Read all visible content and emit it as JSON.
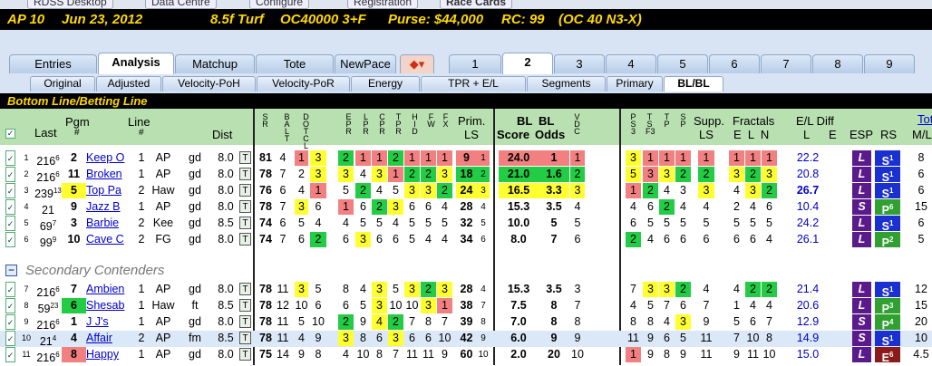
{
  "app_tabs": [
    "RDSS Desktop",
    "Data Centre",
    "Configure",
    "Registration",
    "Race Cards"
  ],
  "header": {
    "track_race": "AP 10",
    "date": "Jun 23, 2012",
    "dist_surf": "8.5f Turf",
    "class": "OC40000 3+F",
    "purse": "Purse: $44,000",
    "rc": "RC: 99",
    "oc": "(OC 40 N3-X)"
  },
  "main_tabs": [
    "Entries",
    "Analysis",
    "Matchup",
    "Tote",
    "NewPace",
    "1",
    "2",
    "3",
    "4",
    "5",
    "6",
    "7",
    "8",
    "9"
  ],
  "sub_tabs": [
    "Original",
    "Adjusted",
    "Velocity-PoH",
    "Velocity-PoR",
    "Energy",
    "TPR + E/L",
    "Segments",
    "Primary",
    "BL/BL"
  ],
  "section_title": "Bottom Line/Betting Line",
  "columns": {
    "last": "Last",
    "pgm": "Pgm",
    "pgm_no": "#",
    "line": "Line",
    "line_no": "#",
    "dist": "Dist",
    "srlabel": "S\nR",
    "balt": "B\nA\nL\nT",
    "dotcl": "D\nO\nT\nC\nL",
    "ep": "E\nP\nR",
    "lp": "L\nP\nR",
    "cp": "C\nP\nR",
    "tp": "T\nP\nR",
    "hid": "H\nI\nD",
    "fw": "F\nW",
    "fx": "F\nX",
    "prim": "Prim.",
    "ls": "LS",
    "bl1": "BL",
    "bl2": "BL",
    "score": "Score",
    "odds": "Odds",
    "vdc": "V\nD\nC",
    "ps": "P\nS\n3",
    "ts": "T\nS\nF3",
    "t3": "T\nP",
    "s3": "S\nP",
    "supp": "Supp.",
    "supp_ls": "LS",
    "fractals": "Fractals",
    "eln": "E  L  N",
    "eldiff": "E/L Diff",
    "l": "L",
    "e": "E",
    "esp": "ESP",
    "rs": "RS",
    "tot": "Tot",
    "ml": "M/L"
  },
  "secondary": "Secondary Contenders",
  "rows": [
    {
      "n": "1",
      "last": "216",
      "ls": "6",
      "pgm": "2",
      "name": "Keep O",
      "line": "1",
      "trk": "AP",
      "cond": "gd",
      "dist": "8.0",
      "sr": "81",
      "b": "4",
      "d1": "1",
      "d2": "3",
      "e": [
        "2",
        "1",
        "1",
        "2",
        "1",
        "1",
        "1"
      ],
      "prim": "9",
      "p2": "1",
      "score": "24.0",
      "odds": "1",
      "vdc": "1",
      "ps": [
        "3",
        "1",
        "1",
        "1"
      ],
      "supp": "1",
      "fr": [
        "1",
        "1",
        "1"
      ],
      "eld": "22.2",
      "esp": "L",
      "rs": "S",
      "rsx": "1",
      "ml": "8",
      "c": [
        "L",
        "L",
        "R",
        "Y",
        "G",
        "R",
        "R",
        "G",
        "R",
        "R",
        "R",
        "R",
        "",
        "R",
        "R",
        "R",
        "Y",
        "R",
        "R",
        "R",
        "R",
        "R",
        "R",
        "R"
      ]
    },
    {
      "n": "2",
      "last": "216",
      "ls": "6",
      "pgm": "11",
      "name": "Broken",
      "line": "1",
      "trk": "AP",
      "cond": "gd",
      "dist": "8.0",
      "sr": "78",
      "b": "7",
      "d1": "2",
      "d2": "3",
      "e": [
        "3",
        "4",
        "3",
        "1",
        "2",
        "2",
        "3"
      ],
      "prim": "18",
      "p2": "2",
      "score": "21.0",
      "odds": "1.6",
      "vdc": "2",
      "ps": [
        "5",
        "3",
        "3",
        "2"
      ],
      "supp": "2",
      "fr": [
        "3",
        "2",
        "3"
      ],
      "eld": "20.8",
      "esp": "L",
      "rs": "S",
      "rsx": "1",
      "ml": "6"
    },
    {
      "n": "3",
      "last": "239",
      "ls": "13",
      "pgm": "5",
      "name": "Top Pa",
      "line": "2",
      "trk": "Haw",
      "cond": "gd",
      "dist": "8.0",
      "sr": "76",
      "b": "6",
      "d1": "4",
      "d2": "1",
      "e": [
        "5",
        "2",
        "4",
        "5",
        "3",
        "3",
        "2"
      ],
      "prim": "24",
      "p2": "3",
      "score": "16.5",
      "odds": "3.3",
      "vdc": "3",
      "ps": [
        "1",
        "2",
        "4",
        "3"
      ],
      "supp": "3",
      "fr": [
        "4",
        "3",
        "2"
      ],
      "eld": "26.7",
      "esp": "L",
      "rs": "S",
      "rsx": "1",
      "ml": "6"
    },
    {
      "n": "4",
      "last": "21",
      "ls": "",
      "pgm": "9",
      "name": "Jazz B",
      "line": "1",
      "trk": "AP",
      "cond": "gd",
      "dist": "8.0",
      "sr": "78",
      "b": "7",
      "d1": "3",
      "d2": "6",
      "e": [
        "1",
        "6",
        "2",
        "3",
        "6",
        "6",
        "4"
      ],
      "prim": "28",
      "p2": "4",
      "score": "15.3",
      "odds": "3.5",
      "vdc": "4",
      "ps": [
        "4",
        "6",
        "2",
        "4"
      ],
      "supp": "4",
      "fr": [
        "2",
        "4",
        "6"
      ],
      "eld": "10.4",
      "esp": "S",
      "rs": "P",
      "rsx": "6",
      "ml": "15"
    },
    {
      "n": "5",
      "last": "69",
      "ls": "7",
      "pgm": "3",
      "name": "Barbie",
      "line": "2",
      "trk": "Kee",
      "cond": "gd",
      "dist": "8.5",
      "sr": "74",
      "b": "6",
      "d1": "5",
      "d2": "4",
      "e": [
        "4",
        "5",
        "5",
        "4",
        "5",
        "5",
        "5"
      ],
      "prim": "32",
      "p2": "5",
      "score": "10.0",
      "odds": "5",
      "vdc": "5",
      "ps": [
        "6",
        "5",
        "5",
        "5"
      ],
      "supp": "5",
      "fr": [
        "5",
        "5",
        "5"
      ],
      "eld": "24.2",
      "esp": "L",
      "rs": "S",
      "rsx": "1",
      "ml": "6"
    },
    {
      "n": "6",
      "last": "99",
      "ls": "9",
      "pgm": "10",
      "name": "Cave C",
      "line": "2",
      "trk": "FG",
      "cond": "gd",
      "dist": "8.0",
      "sr": "74",
      "b": "7",
      "d1": "6",
      "d2": "2",
      "e": [
        "6",
        "3",
        "6",
        "6",
        "5",
        "4",
        "4"
      ],
      "prim": "34",
      "p2": "6",
      "score": "8.0",
      "odds": "7",
      "vdc": "6",
      "ps": [
        "2",
        "4",
        "6",
        "6"
      ],
      "supp": "6",
      "fr": [
        "6",
        "6",
        "4"
      ],
      "eld": "26.1",
      "esp": "L",
      "rs": "P",
      "rsx": "2",
      "ml": "5"
    },
    {
      "n": "7",
      "last": "216",
      "ls": "6",
      "pgm": "7",
      "name": "Ambien",
      "line": "1",
      "trk": "AP",
      "cond": "gd",
      "dist": "8.0",
      "sr": "78",
      "b": "11",
      "d1": "3",
      "d2": "5",
      "e": [
        "8",
        "4",
        "3",
        "5",
        "3",
        "2",
        "3"
      ],
      "prim": "28",
      "p2": "4",
      "score": "15.3",
      "odds": "3.5",
      "vdc": "3",
      "ps": [
        "7",
        "3",
        "3",
        "2"
      ],
      "supp": "4",
      "fr": [
        "4",
        "2",
        "2"
      ],
      "eld": "21.4",
      "esp": "L",
      "rs": "S",
      "rsx": "1",
      "ml": "12"
    },
    {
      "n": "8",
      "last": "59",
      "ls": "23",
      "pgm": "6",
      "name": "Shesab",
      "line": "1",
      "trk": "Haw",
      "cond": "ft",
      "dist": "8.5",
      "sr": "78",
      "b": "12",
      "d1": "10",
      "d2": "6",
      "e": [
        "6",
        "5",
        "3",
        "10",
        "10",
        "3",
        "1"
      ],
      "prim": "38",
      "p2": "7",
      "score": "7.5",
      "odds": "8",
      "vdc": "7",
      "ps": [
        "4",
        "5",
        "7",
        "6"
      ],
      "supp": "7",
      "fr": [
        "1",
        "4",
        "4"
      ],
      "eld": "20.6",
      "esp": "L",
      "rs": "P",
      "rsx": "3",
      "ml": "15"
    },
    {
      "n": "9",
      "last": "216",
      "ls": "6",
      "pgm": "1",
      "name": "J J's",
      "line": "1",
      "trk": "AP",
      "cond": "gd",
      "dist": "8.0",
      "sr": "78",
      "b": "11",
      "d1": "5",
      "d2": "10",
      "e": [
        "2",
        "9",
        "4",
        "2",
        "7",
        "8",
        "7"
      ],
      "prim": "39",
      "p2": "8",
      "score": "7.0",
      "odds": "8",
      "vdc": "8",
      "ps": [
        "8",
        "8",
        "4",
        "3"
      ],
      "supp": "9",
      "fr": [
        "5",
        "6",
        "7"
      ],
      "eld": "12.9",
      "esp": "S",
      "rs": "P",
      "rsx": "4",
      "ml": "20"
    },
    {
      "n": "10",
      "last": "21",
      "ls": "4",
      "pgm": "4",
      "name": "Affair",
      "line": "2",
      "trk": "AP",
      "cond": "fm",
      "dist": "8.5",
      "sr": "78",
      "b": "11",
      "d1": "4",
      "d2": "9",
      "e": [
        "3",
        "8",
        "6",
        "3",
        "6",
        "6",
        "10"
      ],
      "prim": "42",
      "p2": "9",
      "score": "6.0",
      "odds": "9",
      "vdc": "9",
      "ps": [
        "11",
        "9",
        "6",
        "5"
      ],
      "supp": "11",
      "fr": [
        "7",
        "10",
        "8"
      ],
      "eld": "14.9",
      "esp": "S",
      "rs": "S",
      "rsx": "1",
      "ml": "10"
    },
    {
      "n": "11",
      "last": "216",
      "ls": "6",
      "pgm": "8",
      "name": "Happy",
      "line": "1",
      "trk": "AP",
      "cond": "gd",
      "dist": "8.0",
      "sr": "75",
      "b": "14",
      "d1": "9",
      "d2": "8",
      "e": [
        "4",
        "10",
        "8",
        "7",
        "11",
        "11",
        "9"
      ],
      "prim": "60",
      "p2": "10",
      "score": "2.0",
      "odds": "20",
      "vdc": "10",
      "ps": [
        "1",
        "9",
        "8",
        "9"
      ],
      "supp": "11",
      "fr": [
        "9",
        "11",
        "10"
      ],
      "eld": "15.0",
      "esp": "L",
      "rs": "E",
      "rsx": "6",
      "ml": "4.5"
    }
  ]
}
